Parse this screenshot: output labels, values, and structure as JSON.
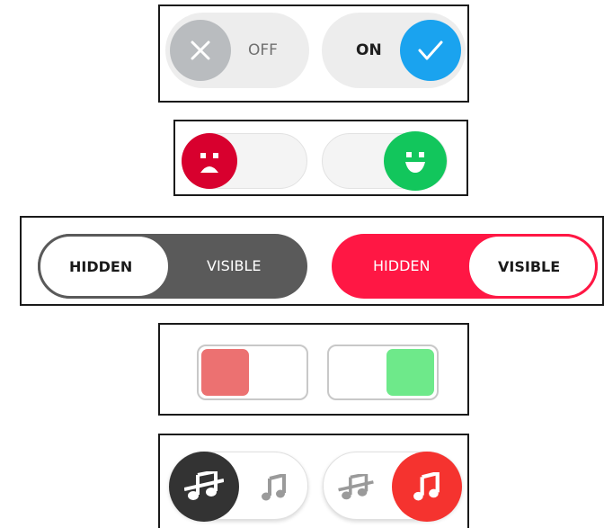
{
  "row1": {
    "off_label": "OFF",
    "on_label": "ON",
    "off_icon": "close-icon",
    "on_icon": "checkmark-icon",
    "off_knob_color": "#b9bcbf",
    "on_knob_color": "#1aa3ef",
    "off_state": false,
    "on_state": true
  },
  "row2": {
    "sad_icon": "sad-face-icon",
    "happy_icon": "happy-face-icon",
    "sad_color": "#d8002e",
    "happy_color": "#12c65c",
    "off_state": false,
    "on_state": true
  },
  "row3": {
    "left_toggle": {
      "hidden_label": "HIDDEN",
      "visible_label": "VISIBLE",
      "selected": "HIDDEN",
      "track_color": "#5a5a5a"
    },
    "right_toggle": {
      "hidden_label": "HIDDEN",
      "visible_label": "VISIBLE",
      "selected": "VISIBLE",
      "track_color": "#ff1744"
    }
  },
  "row4": {
    "off_color": "#ec7171",
    "on_color": "#6ee98a",
    "off_state": false,
    "on_state": true
  },
  "row5": {
    "muted_icon": "music-muted-icon",
    "music_icon": "music-note-icon",
    "off_knob_color": "#333333",
    "on_knob_color": "#f5332f",
    "off_state": false,
    "on_state": true
  }
}
